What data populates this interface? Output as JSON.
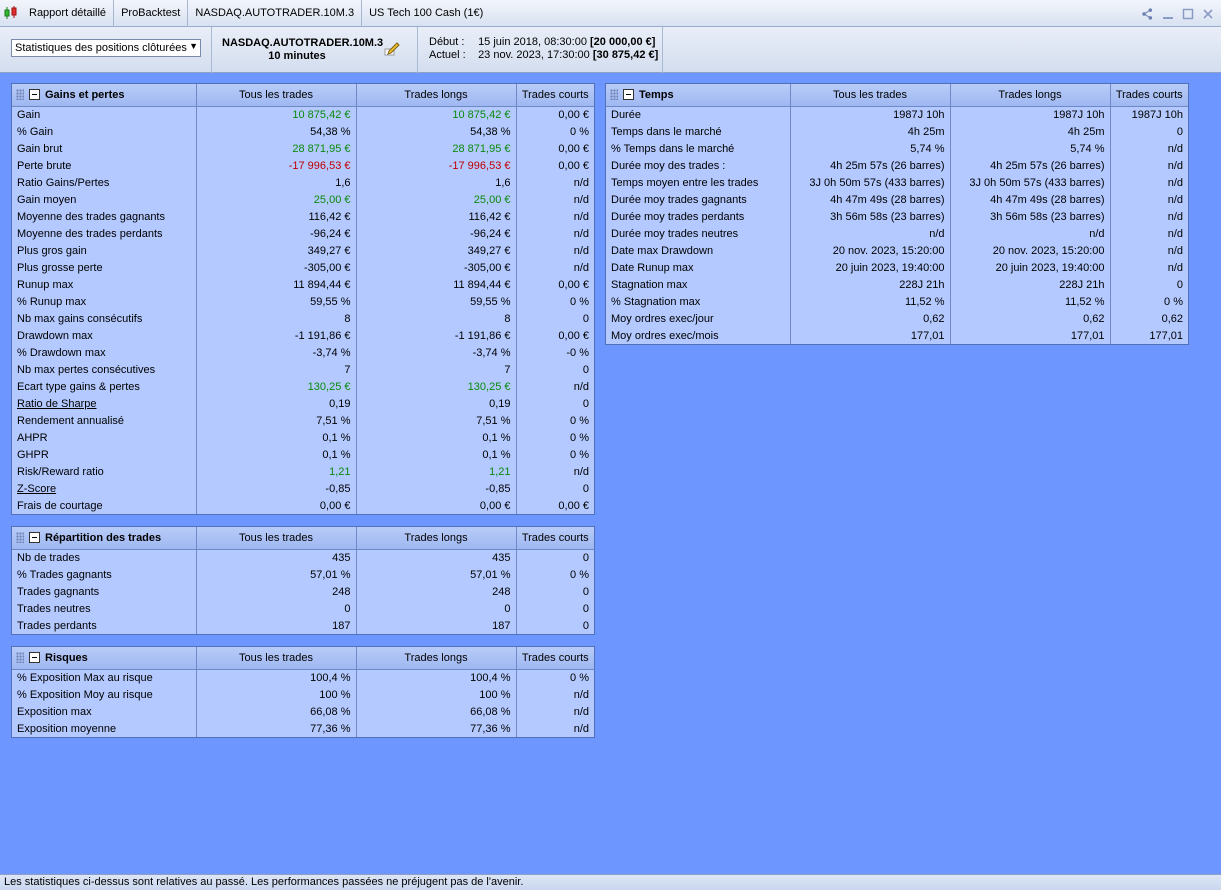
{
  "titlebar": {
    "app_icon": "candlestick-chart-icon",
    "tabs": [
      "Rapport détaillé",
      "ProBacktest",
      "NASDAQ.AUTOTRADER.10M.3",
      "US Tech 100 Cash (1€)"
    ],
    "icons": [
      "share-icon",
      "minimize-icon",
      "maximize-icon",
      "close-icon"
    ]
  },
  "header": {
    "select_value": "Statistiques des positions clôturées",
    "system_name": "NASDAQ.AUTOTRADER.10M.3",
    "timeframe": "10 minutes",
    "start_label": "Début :",
    "start_date": "15 juin 2018, 08:30:00",
    "start_value": "[20 000,00 €]",
    "current_label": "Actuel :",
    "current_date": "23 nov. 2023, 17:30:00",
    "current_value": "[30 875,42 €]"
  },
  "columns": [
    "Tous les trades",
    "Trades longs",
    "Trades courts"
  ],
  "gains": {
    "title": "Gains et pertes",
    "rows": [
      {
        "label": "Gain",
        "all": "10 875,42 €",
        "long": "10 875,42 €",
        "short": "0,00 €",
        "c": "green"
      },
      {
        "label": "% Gain",
        "all": "54,38 %",
        "long": "54,38 %",
        "short": "0 %",
        "c": ""
      },
      {
        "label": "Gain brut",
        "all": "28 871,95 €",
        "long": "28 871,95 €",
        "short": "0,00 €",
        "c": "green"
      },
      {
        "label": "Perte brute",
        "all": "-17 996,53 €",
        "long": "-17 996,53 €",
        "short": "0,00 €",
        "c": "red"
      },
      {
        "label": "Ratio Gains/Pertes",
        "all": "1,6",
        "long": "1,6",
        "short": "n/d",
        "c": ""
      },
      {
        "label": "Gain moyen",
        "all": "25,00 €",
        "long": "25,00 €",
        "short": "n/d",
        "c": "green"
      },
      {
        "label": "Moyenne des trades gagnants",
        "all": "116,42 €",
        "long": "116,42 €",
        "short": "n/d",
        "c": ""
      },
      {
        "label": "Moyenne des trades perdants",
        "all": "-96,24 €",
        "long": "-96,24 €",
        "short": "n/d",
        "c": ""
      },
      {
        "label": "Plus gros gain",
        "all": "349,27 €",
        "long": "349,27 €",
        "short": "n/d",
        "c": ""
      },
      {
        "label": "Plus grosse perte",
        "all": "-305,00 €",
        "long": "-305,00 €",
        "short": "n/d",
        "c": ""
      },
      {
        "label": "Runup max",
        "all": "11 894,44 €",
        "long": "11 894,44 €",
        "short": "0,00 €",
        "c": ""
      },
      {
        "label": "% Runup max",
        "all": "59,55 %",
        "long": "59,55 %",
        "short": "0 %",
        "c": ""
      },
      {
        "label": "Nb max gains consécutifs",
        "all": "8",
        "long": "8",
        "short": "0",
        "c": ""
      },
      {
        "label": "Drawdown max",
        "all": "-1 191,86 €",
        "long": "-1 191,86 €",
        "short": "0,00 €",
        "c": ""
      },
      {
        "label": "% Drawdown max",
        "all": "-3,74 %",
        "long": "-3,74 %",
        "short": "-0 %",
        "c": ""
      },
      {
        "label": "Nb max pertes consécutives",
        "all": "7",
        "long": "7",
        "short": "0",
        "c": ""
      },
      {
        "label": "Ecart type gains & pertes",
        "all": "130,25 €",
        "long": "130,25 €",
        "short": "n/d",
        "c": "green"
      },
      {
        "label": "Ratio de Sharpe",
        "all": "0,19",
        "long": "0,19",
        "short": "0",
        "c": "",
        "u": true
      },
      {
        "label": "Rendement annualisé",
        "all": "7,51 %",
        "long": "7,51 %",
        "short": "0 %",
        "c": ""
      },
      {
        "label": "AHPR",
        "all": "0,1 %",
        "long": "0,1 %",
        "short": "0 %",
        "c": ""
      },
      {
        "label": "GHPR",
        "all": "0,1 %",
        "long": "0,1 %",
        "short": "0 %",
        "c": ""
      },
      {
        "label": "Risk/Reward ratio",
        "all": "1,21",
        "long": "1,21",
        "short": "n/d",
        "c": "green"
      },
      {
        "label": "Z-Score",
        "all": "-0,85",
        "long": "-0,85",
        "short": "0",
        "c": "",
        "u": true
      },
      {
        "label": "Frais de courtage",
        "all": "0,00 €",
        "long": "0,00 €",
        "short": "0,00 €",
        "c": ""
      }
    ]
  },
  "repartition": {
    "title": "Répartition des trades",
    "rows": [
      {
        "label": "Nb de trades",
        "all": "435",
        "long": "435",
        "short": "0",
        "c": ""
      },
      {
        "label": "% Trades gagnants",
        "all": "57,01 %",
        "long": "57,01 %",
        "short": "0 %",
        "c": ""
      },
      {
        "label": "Trades gagnants",
        "all": "248",
        "long": "248",
        "short": "0",
        "c": ""
      },
      {
        "label": "Trades neutres",
        "all": "0",
        "long": "0",
        "short": "0",
        "c": ""
      },
      {
        "label": "Trades perdants",
        "all": "187",
        "long": "187",
        "short": "0",
        "c": ""
      }
    ]
  },
  "risques": {
    "title": "Risques",
    "rows": [
      {
        "label": "% Exposition Max au risque",
        "all": "100,4 %",
        "long": "100,4 %",
        "short": "0 %",
        "c": ""
      },
      {
        "label": "% Exposition Moy au risque",
        "all": "100 %",
        "long": "100 %",
        "short": "n/d",
        "c": ""
      },
      {
        "label": "Exposition max",
        "all": "66,08 %",
        "long": "66,08 %",
        "short": "n/d",
        "c": ""
      },
      {
        "label": "Exposition moyenne",
        "all": "77,36 %",
        "long": "77,36 %",
        "short": "n/d",
        "c": ""
      }
    ]
  },
  "temps": {
    "title": "Temps",
    "rows": [
      {
        "label": "Durée",
        "all": "1987J 10h",
        "long": "1987J 10h",
        "short": "1987J 10h",
        "c": ""
      },
      {
        "label": "Temps dans le marché",
        "all": "4h 25m",
        "long": "4h 25m",
        "short": "0",
        "c": ""
      },
      {
        "label": "% Temps dans le marché",
        "all": "5,74 %",
        "long": "5,74 %",
        "short": "n/d",
        "c": ""
      },
      {
        "label": "Durée moy des trades :",
        "all": "4h 25m 57s (26 barres)",
        "long": "4h 25m 57s (26 barres)",
        "short": "n/d",
        "c": ""
      },
      {
        "label": "Temps moyen entre les trades",
        "all": "3J 0h 50m 57s (433 barres)",
        "long": "3J 0h 50m 57s (433 barres)",
        "short": "n/d",
        "c": ""
      },
      {
        "label": "Durée moy trades gagnants",
        "all": "4h 47m 49s (28 barres)",
        "long": "4h 47m 49s (28 barres)",
        "short": "n/d",
        "c": ""
      },
      {
        "label": "Durée moy trades perdants",
        "all": "3h 56m 58s (23 barres)",
        "long": "3h 56m 58s (23 barres)",
        "short": "n/d",
        "c": ""
      },
      {
        "label": "Durée moy trades neutres",
        "all": "n/d",
        "long": "n/d",
        "short": "n/d",
        "c": ""
      },
      {
        "label": "Date max Drawdown",
        "all": "20 nov. 2023, 15:20:00",
        "long": "20 nov. 2023, 15:20:00",
        "short": "n/d",
        "c": ""
      },
      {
        "label": "Date Runup max",
        "all": "20 juin 2023, 19:40:00",
        "long": "20 juin 2023, 19:40:00",
        "short": "n/d",
        "c": ""
      },
      {
        "label": "Stagnation max",
        "all": "228J 21h",
        "long": "228J 21h",
        "short": "0",
        "c": ""
      },
      {
        "label": "% Stagnation max",
        "all": "11,52 %",
        "long": "11,52 %",
        "short": "0 %",
        "c": ""
      },
      {
        "label": "Moy ordres exec/jour",
        "all": "0,62",
        "long": "0,62",
        "short": "0,62",
        "c": ""
      },
      {
        "label": "Moy ordres exec/mois",
        "all": "177,01",
        "long": "177,01",
        "short": "177,01",
        "c": ""
      }
    ]
  },
  "footer": {
    "text": "Les statistiques ci-dessus sont relatives au passé. Les performances passées ne préjugent pas de l'avenir."
  }
}
